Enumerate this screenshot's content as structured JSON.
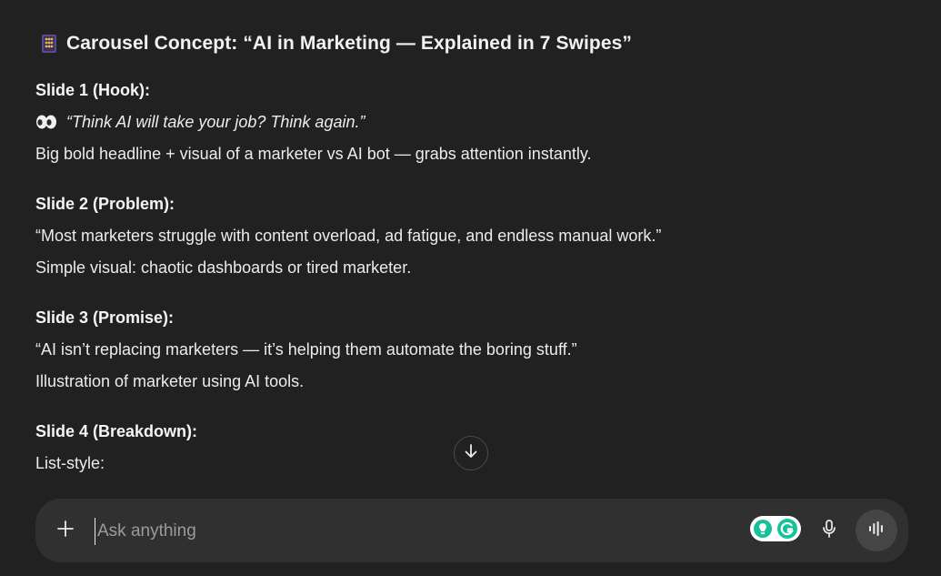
{
  "message": {
    "title": "Carousel Concept: “AI in Marketing — Explained in 7 Swipes”",
    "slides": [
      {
        "heading": "Slide 1 (Hook):",
        "quote": "“Think AI will take your job? Think again.”",
        "body": "Big bold headline + visual of a marketer vs AI bot — grabs attention instantly."
      },
      {
        "heading": "Slide 2 (Problem):",
        "quote": "“Most marketers struggle with content overload, ad fatigue, and endless manual work.”",
        "body": "Simple visual: chaotic dashboards or tired marketer."
      },
      {
        "heading": "Slide 3 (Promise):",
        "quote": "“AI isn’t replacing marketers — it’s helping them automate the boring stuff.”",
        "body": "Illustration of marketer using AI tools."
      },
      {
        "heading": "Slide 4 (Breakdown):",
        "body": "List-style:"
      }
    ]
  },
  "composer": {
    "placeholder": "Ask anything"
  },
  "icons": {
    "title": "abacus-icon",
    "hook": "eyes-icon",
    "scroll": "arrow-down-icon",
    "add": "plus-icon",
    "extension": "grammarly-icon",
    "mic": "microphone-icon",
    "voice": "voice-waveform-icon"
  },
  "colors": {
    "background": "#212121",
    "composer": "#303030",
    "grammarly": "#15c39a"
  }
}
